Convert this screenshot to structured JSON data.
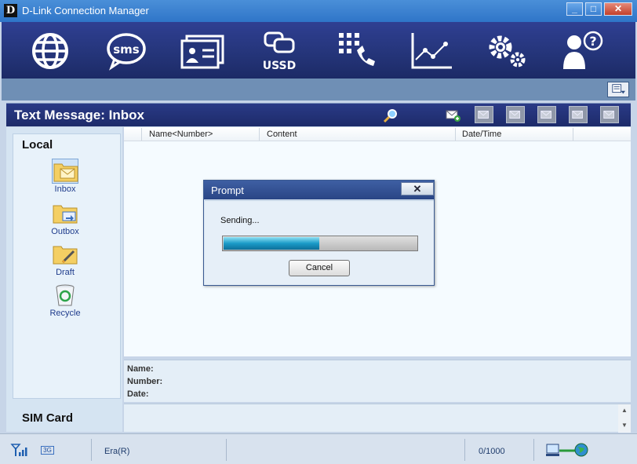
{
  "window": {
    "logo": "D",
    "title": "D-Link Connection Manager",
    "minimize": "_",
    "maximize": "□",
    "close": "✕"
  },
  "toolbar": {
    "items": [
      {
        "icon": "globe-icon"
      },
      {
        "icon": "sms-icon",
        "label": "sms"
      },
      {
        "icon": "contacts-icon"
      },
      {
        "icon": "ussd-icon",
        "label": "USSD"
      },
      {
        "icon": "dialer-icon"
      },
      {
        "icon": "statistics-icon"
      },
      {
        "icon": "settings-icon"
      },
      {
        "icon": "help-icon",
        "label": "?"
      }
    ]
  },
  "header": {
    "title": "Text Message: Inbox"
  },
  "left_pane": {
    "local_label": "Local",
    "folders": [
      {
        "label": "Inbox",
        "icon": "inbox-folder-icon",
        "selected": true
      },
      {
        "label": "Outbox",
        "icon": "outbox-folder-icon",
        "selected": false
      },
      {
        "label": "Draft",
        "icon": "draft-folder-icon",
        "selected": false
      },
      {
        "label": "Recycle",
        "icon": "recycle-icon",
        "selected": false
      }
    ],
    "sim_label": "SIM Card"
  },
  "list": {
    "columns": [
      "Name<Number>",
      "Content",
      "Date/Time"
    ]
  },
  "detail": {
    "name_label": "Name:",
    "number_label": "Number:",
    "date_label": "Date:"
  },
  "status": {
    "network_type": "3G",
    "operator": "Era(R)",
    "sms_count": "0/1000"
  },
  "dialog": {
    "title": "Prompt",
    "close": "✕",
    "message": "Sending...",
    "progress": 0.49,
    "cancel_label": "Cancel"
  },
  "colors": {
    "toolbar_bg": "#243478",
    "header_bg": "#1d2b6a",
    "progress_fill": "#1a9bc8"
  }
}
